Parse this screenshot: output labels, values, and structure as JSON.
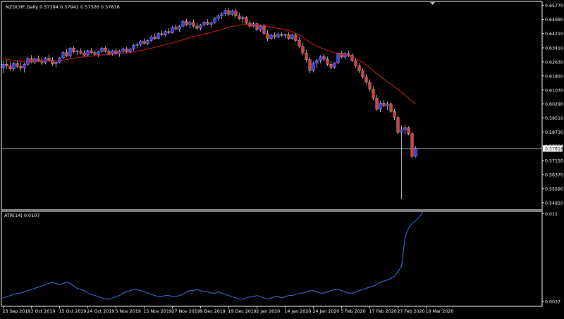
{
  "colors": {
    "background": "#000000",
    "frame": "#ffffff",
    "text": "#ffffff",
    "bull_body": "#3b3bff",
    "bear_body": "#e03c3c",
    "wick": "#d8d8d8",
    "ma_line": "#d61e1e",
    "atr_line": "#3c7ae6",
    "price_line": "#c8c8c8"
  },
  "chart_data": [
    {
      "type": "candlestick",
      "title": "NZDCHF,Daily  0.57384 0.57942 0.57326 0.57816",
      "symbol": "NZDCHF",
      "timeframe": "Daily",
      "ohlc_last": {
        "open": 0.57384,
        "high": 0.57942,
        "low": 0.57326,
        "close": 0.57816
      },
      "current_price_label": "0.57816",
      "ylim": [
        0.5441,
        0.6599
      ],
      "y_ticks": [
        "0.65770",
        "0.64990",
        "0.64210",
        "0.63410",
        "0.62630",
        "0.61850",
        "0.61070",
        "0.60290",
        "0.59510",
        "0.58730",
        "0.57950",
        "0.57150",
        "0.56370",
        "0.55590",
        "0.54810"
      ],
      "y_tick_values": [
        0.6577,
        0.6499,
        0.6421,
        0.6341,
        0.6263,
        0.6185,
        0.6107,
        0.6029,
        0.5951,
        0.5873,
        0.5795,
        0.5715,
        0.5637,
        0.5559,
        0.5481
      ],
      "x_ticks": [
        "23 Sep 2019",
        "3 Oct 2019",
        "15 Oct 2019",
        "24 Oct 2019",
        "5 Nov 2019",
        "15 Nov 2019",
        "27 Nov 2019",
        "9 Dec 2019",
        "19 Dec 2019",
        "2 Jan 2020",
        "14 Jan 2020",
        "24 Jan 2020",
        "5 Feb 2020",
        "17 Feb 2020",
        "27 Feb 2020",
        "10 Mar 2020"
      ],
      "x_tick_index": [
        0,
        8,
        16,
        24,
        32,
        40,
        48,
        56,
        64,
        72,
        80,
        88,
        96,
        104,
        112,
        120
      ],
      "candles": [
        [
          0.623,
          0.627,
          0.62,
          0.625
        ],
        [
          0.625,
          0.6275,
          0.6225,
          0.624
        ],
        [
          0.624,
          0.6265,
          0.6215,
          0.6225
        ],
        [
          0.6225,
          0.6262,
          0.621,
          0.6255
        ],
        [
          0.6255,
          0.6272,
          0.623,
          0.6238
        ],
        [
          0.6238,
          0.626,
          0.6212,
          0.6228
        ],
        [
          0.6228,
          0.6258,
          0.6205,
          0.625
        ],
        [
          0.625,
          0.629,
          0.624,
          0.6282
        ],
        [
          0.6282,
          0.63,
          0.6255,
          0.6262
        ],
        [
          0.6262,
          0.6288,
          0.625,
          0.628
        ],
        [
          0.628,
          0.6298,
          0.6262,
          0.627
        ],
        [
          0.627,
          0.6285,
          0.6245,
          0.6258
        ],
        [
          0.6258,
          0.629,
          0.625,
          0.6285
        ],
        [
          0.6285,
          0.6305,
          0.6265,
          0.6272
        ],
        [
          0.6272,
          0.629,
          0.624,
          0.6252
        ],
        [
          0.6252,
          0.627,
          0.6232,
          0.6262
        ],
        [
          0.6262,
          0.629,
          0.6255,
          0.6285
        ],
        [
          0.6285,
          0.6322,
          0.6278,
          0.6315
        ],
        [
          0.6315,
          0.6335,
          0.629,
          0.6298
        ],
        [
          0.6298,
          0.6345,
          0.629,
          0.634
        ],
        [
          0.634,
          0.635,
          0.631,
          0.6318
        ],
        [
          0.6318,
          0.633,
          0.63,
          0.6322
        ],
        [
          0.6322,
          0.6338,
          0.6305,
          0.6312
        ],
        [
          0.6312,
          0.6328,
          0.629,
          0.63
        ],
        [
          0.63,
          0.633,
          0.6295,
          0.6325
        ],
        [
          0.6325,
          0.634,
          0.6308,
          0.6315
        ],
        [
          0.6315,
          0.6328,
          0.6295,
          0.6305
        ],
        [
          0.6305,
          0.6325,
          0.629,
          0.632
        ],
        [
          0.632,
          0.6345,
          0.6315,
          0.634
        ],
        [
          0.634,
          0.6352,
          0.6315,
          0.6322
        ],
        [
          0.6322,
          0.6335,
          0.63,
          0.6308
        ],
        [
          0.6308,
          0.633,
          0.6298,
          0.6325
        ],
        [
          0.6325,
          0.6338,
          0.63,
          0.631
        ],
        [
          0.631,
          0.633,
          0.6292,
          0.6322
        ],
        [
          0.6322,
          0.6342,
          0.631,
          0.6335
        ],
        [
          0.6335,
          0.6345,
          0.6312,
          0.6318
        ],
        [
          0.6318,
          0.634,
          0.631,
          0.6335
        ],
        [
          0.6335,
          0.6362,
          0.6325,
          0.6355
        ],
        [
          0.6355,
          0.637,
          0.634,
          0.636
        ],
        [
          0.636,
          0.6385,
          0.6348,
          0.6378
        ],
        [
          0.6378,
          0.6395,
          0.636,
          0.6365
        ],
        [
          0.6365,
          0.6388,
          0.6355,
          0.6382
        ],
        [
          0.6382,
          0.641,
          0.6375,
          0.6402
        ],
        [
          0.6402,
          0.6418,
          0.6385,
          0.6392
        ],
        [
          0.6392,
          0.6425,
          0.6388,
          0.642
        ],
        [
          0.642,
          0.6438,
          0.6405,
          0.6412
        ],
        [
          0.6412,
          0.644,
          0.6405,
          0.6432
        ],
        [
          0.6432,
          0.645,
          0.6415,
          0.6425
        ],
        [
          0.6425,
          0.6462,
          0.642,
          0.6455
        ],
        [
          0.6455,
          0.6472,
          0.6438,
          0.6445
        ],
        [
          0.6445,
          0.6468,
          0.643,
          0.646
        ],
        [
          0.646,
          0.6495,
          0.6455,
          0.6488
        ],
        [
          0.6488,
          0.6502,
          0.6462,
          0.647
        ],
        [
          0.647,
          0.649,
          0.645,
          0.6482
        ],
        [
          0.6482,
          0.6498,
          0.6455,
          0.6462
        ],
        [
          0.6462,
          0.6478,
          0.644,
          0.645
        ],
        [
          0.645,
          0.6475,
          0.6438,
          0.6468
        ],
        [
          0.6468,
          0.649,
          0.646,
          0.6485
        ],
        [
          0.6485,
          0.65,
          0.6465,
          0.6472
        ],
        [
          0.6472,
          0.6488,
          0.6452,
          0.648
        ],
        [
          0.648,
          0.6512,
          0.6475,
          0.6505
        ],
        [
          0.6505,
          0.6525,
          0.649,
          0.6518
        ],
        [
          0.6518,
          0.654,
          0.65,
          0.653
        ],
        [
          0.653,
          0.656,
          0.6515,
          0.6548
        ],
        [
          0.6548,
          0.6562,
          0.652,
          0.6528
        ],
        [
          0.6528,
          0.6555,
          0.652,
          0.6545
        ],
        [
          0.6545,
          0.6558,
          0.651,
          0.6518
        ],
        [
          0.6518,
          0.6535,
          0.6495,
          0.6502
        ],
        [
          0.6502,
          0.652,
          0.648,
          0.651
        ],
        [
          0.651,
          0.6518,
          0.647,
          0.6478
        ],
        [
          0.6478,
          0.6492,
          0.645,
          0.6462
        ],
        [
          0.6462,
          0.6485,
          0.6455,
          0.6475
        ],
        [
          0.6475,
          0.6482,
          0.6435,
          0.6442
        ],
        [
          0.6442,
          0.647,
          0.6432,
          0.6462
        ],
        [
          0.6462,
          0.6475,
          0.6415,
          0.642
        ],
        [
          0.642,
          0.6438,
          0.638,
          0.6392
        ],
        [
          0.6392,
          0.642,
          0.6385,
          0.6412
        ],
        [
          0.6412,
          0.6428,
          0.639,
          0.6402
        ],
        [
          0.6402,
          0.6425,
          0.6395,
          0.6418
        ],
        [
          0.6418,
          0.643,
          0.64,
          0.641
        ],
        [
          0.641,
          0.6422,
          0.6395,
          0.6415
        ],
        [
          0.6415,
          0.643,
          0.6385,
          0.6392
        ],
        [
          0.6392,
          0.642,
          0.6388,
          0.6412
        ],
        [
          0.6412,
          0.6425,
          0.6375,
          0.6382
        ],
        [
          0.6382,
          0.64,
          0.634,
          0.635
        ],
        [
          0.635,
          0.6365,
          0.63,
          0.6312
        ],
        [
          0.6312,
          0.633,
          0.626,
          0.6275
        ],
        [
          0.6275,
          0.629,
          0.62,
          0.6215
        ],
        [
          0.6215,
          0.6265,
          0.6205,
          0.6255
        ],
        [
          0.6255,
          0.628,
          0.623,
          0.6272
        ],
        [
          0.6272,
          0.63,
          0.6255,
          0.6292
        ],
        [
          0.6292,
          0.631,
          0.6265,
          0.6278
        ],
        [
          0.6278,
          0.6292,
          0.624,
          0.625
        ],
        [
          0.625,
          0.6268,
          0.622,
          0.6232
        ],
        [
          0.6232,
          0.6262,
          0.6225,
          0.6258
        ],
        [
          0.6258,
          0.6318,
          0.625,
          0.6312
        ],
        [
          0.6312,
          0.6325,
          0.6282,
          0.629
        ],
        [
          0.629,
          0.6318,
          0.628,
          0.631
        ],
        [
          0.631,
          0.6325,
          0.629,
          0.63
        ],
        [
          0.63,
          0.6312,
          0.6262,
          0.627
        ],
        [
          0.627,
          0.6285,
          0.623,
          0.6242
        ],
        [
          0.6242,
          0.6255,
          0.62,
          0.6212
        ],
        [
          0.6212,
          0.6225,
          0.617,
          0.618
        ],
        [
          0.618,
          0.6195,
          0.614,
          0.615
        ],
        [
          0.615,
          0.6165,
          0.61,
          0.6112
        ],
        [
          0.6112,
          0.6128,
          0.605,
          0.6062
        ],
        [
          0.6062,
          0.608,
          0.599,
          0.6
        ],
        [
          0.6,
          0.6045,
          0.5985,
          0.6035
        ],
        [
          0.6035,
          0.6052,
          0.601,
          0.602
        ],
        [
          0.602,
          0.6042,
          0.5995,
          0.603
        ],
        [
          0.603,
          0.6038,
          0.598,
          0.5988
        ],
        [
          0.5988,
          0.6,
          0.594,
          0.5955
        ],
        [
          0.5955,
          0.5965,
          0.586,
          0.587
        ],
        [
          0.587,
          0.591,
          0.55,
          0.5885
        ],
        [
          0.5885,
          0.5915,
          0.586,
          0.5898
        ],
        [
          0.5898,
          0.5905,
          0.5855,
          0.5865
        ],
        [
          0.5865,
          0.5872,
          0.5728,
          0.5738
        ],
        [
          0.57384,
          0.57942,
          0.57326,
          0.57816
        ]
      ],
      "ma": [
        0.6282,
        0.6278,
        0.6274,
        0.6271,
        0.6268,
        0.6266,
        0.6264,
        0.6263,
        0.6263,
        0.6264,
        0.6265,
        0.6266,
        0.6267,
        0.6268,
        0.6268,
        0.6269,
        0.627,
        0.6273,
        0.6276,
        0.628,
        0.6283,
        0.6286,
        0.6289,
        0.6291,
        0.6293,
        0.6295,
        0.6297,
        0.6299,
        0.6301,
        0.6303,
        0.6304,
        0.6306,
        0.6307,
        0.6309,
        0.6311,
        0.6313,
        0.6315,
        0.6318,
        0.6322,
        0.6326,
        0.633,
        0.6334,
        0.6339,
        0.6344,
        0.6349,
        0.6354,
        0.6359,
        0.6364,
        0.6369,
        0.6375,
        0.638,
        0.6386,
        0.6392,
        0.6398,
        0.6403,
        0.6408,
        0.6412,
        0.6417,
        0.6422,
        0.6427,
        0.6432,
        0.6438,
        0.6444,
        0.645,
        0.6455,
        0.646,
        0.6464,
        0.6467,
        0.647,
        0.6471,
        0.6472,
        0.6472,
        0.647,
        0.6468,
        0.6465,
        0.6461,
        0.6457,
        0.6453,
        0.6449,
        0.6446,
        0.6442,
        0.6437,
        0.6431,
        0.6423,
        0.6413,
        0.64,
        0.6386,
        0.6372,
        0.636,
        0.635,
        0.6342,
        0.6335,
        0.6328,
        0.632,
        0.6314,
        0.631,
        0.6306,
        0.6302,
        0.6297,
        0.629,
        0.6282,
        0.6272,
        0.626,
        0.6246,
        0.623,
        0.6214,
        0.6198,
        0.6182,
        0.6167,
        0.6153,
        0.6139,
        0.6125,
        0.611,
        0.6093,
        0.6078,
        0.6062,
        0.6045,
        0.6028
      ],
      "ma_start_index": 0
    },
    {
      "type": "line",
      "title": "ATR(14) 0.0107",
      "indicator": "ATR(14)",
      "value_label": "0.0107",
      "y_ticks": [
        "0.011",
        "0.0037"
      ],
      "y_tick_values": [
        0.011,
        0.0037
      ],
      "ylim": [
        0.0033,
        0.0112
      ],
      "values": [
        0.004,
        0.0041,
        0.0042,
        0.0043,
        0.0044,
        0.0044,
        0.0045,
        0.0046,
        0.0047,
        0.0048,
        0.0049,
        0.005,
        0.0051,
        0.0052,
        0.0053,
        0.0052,
        0.0051,
        0.0052,
        0.0053,
        0.0052,
        0.005,
        0.0048,
        0.0047,
        0.0046,
        0.0044,
        0.0043,
        0.0042,
        0.0041,
        0.004,
        0.0039,
        0.0039,
        0.004,
        0.0041,
        0.0042,
        0.0044,
        0.0045,
        0.0046,
        0.0047,
        0.0047,
        0.0046,
        0.0045,
        0.0044,
        0.0043,
        0.0042,
        0.0041,
        0.0041,
        0.0042,
        0.0042,
        0.0041,
        0.0041,
        0.0042,
        0.0043,
        0.0045,
        0.0046,
        0.0046,
        0.0047,
        0.0046,
        0.0045,
        0.0045,
        0.0044,
        0.0044,
        0.0045,
        0.0044,
        0.0043,
        0.0042,
        0.0041,
        0.004,
        0.0039,
        0.0039,
        0.004,
        0.0041,
        0.0041,
        0.0042,
        0.0041,
        0.004,
        0.0039,
        0.004,
        0.0041,
        0.0041,
        0.004,
        0.0041,
        0.0042,
        0.0042,
        0.0043,
        0.0044,
        0.0044,
        0.0045,
        0.0046,
        0.0046,
        0.0045,
        0.0044,
        0.0044,
        0.0045,
        0.0046,
        0.0047,
        0.0047,
        0.0046,
        0.0045,
        0.0044,
        0.0044,
        0.0045,
        0.0046,
        0.0047,
        0.0048,
        0.0049,
        0.005,
        0.0051,
        0.0053,
        0.0054,
        0.0055,
        0.0056,
        0.0058,
        0.0062,
        0.0066,
        0.009,
        0.0098,
        0.0102,
        0.0104,
        0.0107,
        0.0111
      ]
    }
  ]
}
